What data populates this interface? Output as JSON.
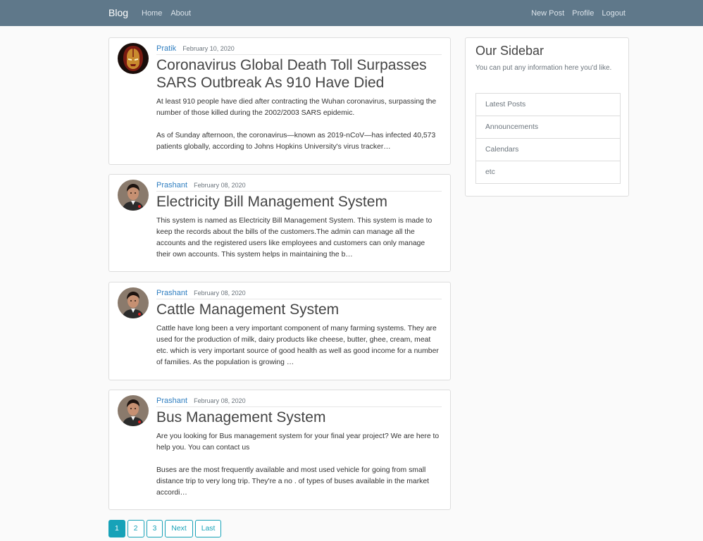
{
  "navbar": {
    "brand": "Blog",
    "left_links": [
      "Home",
      "About"
    ],
    "right_links": [
      "New Post",
      "Profile",
      "Logout"
    ]
  },
  "posts": [
    {
      "author": "Pratik",
      "date": "February 10, 2020",
      "title": "Coronavirus Global Death Toll Surpasses SARS Outbreak As 910 Have Died",
      "paragraphs": [
        "At least 910 people have died after contracting the Wuhan coronavirus, surpassing the number of those killed during the 2002/2003 SARS epidemic.",
        "As of Sunday afternoon, the coronavirus—known as 2019-nCoV—has infected 40,573 patients globally, according to Johns Hopkins University's virus tracker…"
      ],
      "avatar": "ironman-avatar"
    },
    {
      "author": "Prashant",
      "date": "February 08, 2020",
      "title": "Electricity Bill Management System",
      "paragraphs": [
        "This system is named as Electricity Bill Management System. This system is made to keep the records about the bills of the customers.The admin can manage all the accounts and the registered users like employees and customers can only manage their own accounts. This system helps in maintaining the b…"
      ],
      "avatar": "user-avatar"
    },
    {
      "author": "Prashant",
      "date": "February 08, 2020",
      "title": "Cattle Management System",
      "paragraphs": [
        "Cattle have long been a very important component of many farming systems. They are used for the production of milk, dairy products like cheese, butter, ghee, cream, meat etc. which is very important source of good health as well as good income for a number of families. As the population is growing …"
      ],
      "avatar": "user-avatar"
    },
    {
      "author": "Prashant",
      "date": "February 08, 2020",
      "title": "Bus Management System",
      "paragraphs": [
        "Are you looking for Bus management system for your final year project? We are here to help you. You can contact us",
        "Buses are the most frequently available and most used vehicle for going from small distance trip to very long trip. They're a no . of types of buses available in the market accordi…"
      ],
      "avatar": "user-avatar"
    }
  ],
  "sidebar": {
    "title": "Our Sidebar",
    "description": "You can put any information here you'd like.",
    "items": [
      "Latest Posts",
      "Announcements",
      "Calendars",
      "etc"
    ]
  },
  "pagination": {
    "pages": [
      "1",
      "2",
      "3"
    ],
    "next": "Next",
    "last": "Last"
  },
  "colors": {
    "navbar": "#5f788a",
    "link": "#2f7ec0",
    "accent": "#17a2b8"
  }
}
